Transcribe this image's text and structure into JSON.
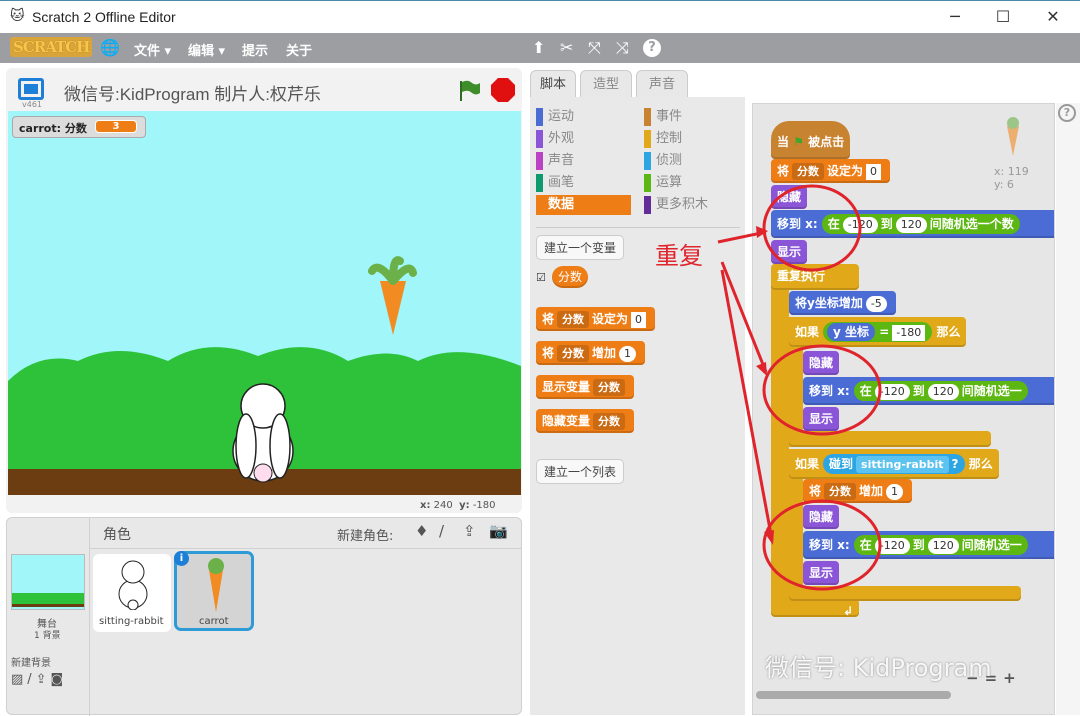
{
  "window": {
    "title": "Scratch 2 Offline Editor",
    "minimize": "─",
    "maximize": "☐",
    "close": "✕"
  },
  "menubar": {
    "logo": "SCRATCH",
    "items": [
      "文件 ▾",
      "编辑 ▾",
      "提示",
      "关于"
    ]
  },
  "stage": {
    "title": "微信号:KidProgram  制片人:权芹乐",
    "version": "v461",
    "monitor_label": "carrot: 分数",
    "monitor_value": "3",
    "coords_x_label": "x:",
    "coords_x": "240",
    "coords_y_label": "y:",
    "coords_y": "-180"
  },
  "sprites": {
    "header": "角色",
    "new_sprite": "新建角色:",
    "stage_label": "舞台",
    "backdrops": "1 背景",
    "new_backdrop": "新建背景",
    "items": [
      {
        "name": "sitting-rabbit"
      },
      {
        "name": "carrot",
        "selected": true
      }
    ]
  },
  "tabs": [
    "脚本",
    "造型",
    "声音"
  ],
  "categories": [
    {
      "label": "运动",
      "color": "#4a6cd4"
    },
    {
      "label": "外观",
      "color": "#8a55d7"
    },
    {
      "label": "声音",
      "color": "#bb42c3"
    },
    {
      "label": "画笔",
      "color": "#0e9a6c"
    },
    {
      "label": "数据",
      "color": "#ee7d16",
      "active": true
    },
    {
      "label": "事件",
      "color": "#c88330"
    },
    {
      "label": "控制",
      "color": "#e1a91a"
    },
    {
      "label": "侦测",
      "color": "#2ca5e2"
    },
    {
      "label": "运算",
      "color": "#5cb712"
    },
    {
      "label": "更多积木",
      "color": "#632d99"
    }
  ],
  "palette": {
    "make_variable": "建立一个变量",
    "variable": "分数",
    "set": "将",
    "set_to": "设定为",
    "set_val": "0",
    "change": "增加",
    "change_val": "1",
    "show_var": "显示变量",
    "hide_var": "隐藏变量",
    "var_dd": "分数",
    "make_list": "建立一个列表"
  },
  "script": {
    "when": "当",
    "clicked": "被点击",
    "set": "将",
    "var": "分数",
    "set_to": "设定为",
    "zero": "0",
    "hide": "隐藏",
    "show": "显示",
    "goto": "移到 x:",
    "in": "在",
    "from": "-120",
    "to": "到",
    "to_val": "120",
    "random_full": "间随机选一个数",
    "random_cut": "间随机选一",
    "forever": "重复执行",
    "change_y": "将y坐标增加",
    "change_y_val": "-5",
    "if": "如果",
    "then": "那么",
    "y_pos": "y 坐标",
    "eq": "=",
    "eq_val": "-180",
    "touching": "碰到",
    "touch_target": "sitting-rabbit",
    "q": "?",
    "change": "增加",
    "one": "1"
  },
  "sprite_info": {
    "x": "x: 119",
    "y": "y: 6"
  },
  "annotation": {
    "text": "重复",
    "color": "#e0242c"
  },
  "watermark": "微信号: KidProgram",
  "zoom": {
    "out": "−",
    "reset": "=",
    "in": "+"
  }
}
